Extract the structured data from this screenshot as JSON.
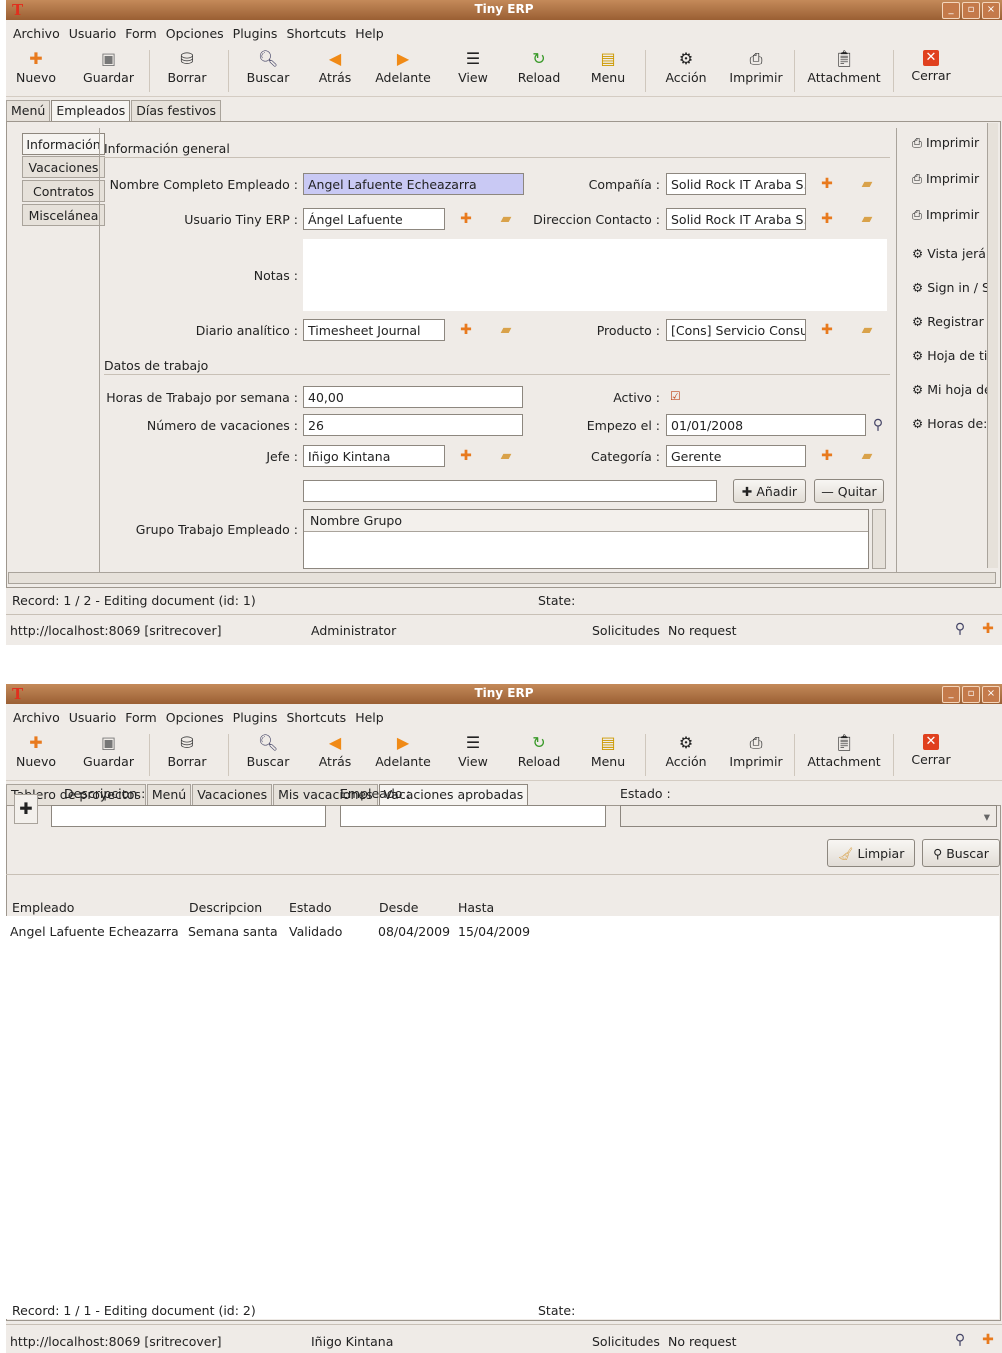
{
  "window1": {
    "title": "Tiny ERP",
    "menu": [
      "Archivo",
      "Usuario",
      "Form",
      "Opciones",
      "Plugins",
      "Shortcuts",
      "Help"
    ],
    "toolbar": [
      "Nuevo",
      "Guardar",
      "Borrar",
      "Buscar",
      "Atrás",
      "Adelante",
      "View",
      "Reload",
      "Menu",
      "Acción",
      "Imprimir",
      "Attachment",
      "Cerrar"
    ],
    "tabs": [
      "Menú",
      "Empleados",
      "Días festivos"
    ],
    "vtabs": [
      "Información",
      "Vacaciones",
      "Contratos",
      "Miscelánea"
    ],
    "section_general": "Información general",
    "labels": {
      "nombre": "Nombre Completo Empleado :",
      "compania": "Compañía :",
      "usuario": "Usuario Tiny ERP :",
      "direccion": "Direccion Contacto :",
      "notas": "Notas :",
      "diario": "Diario analítico :",
      "producto": "Producto :",
      "horas": "Horas de Trabajo por semana :",
      "activo": "Activo :",
      "vacaciones": "Número de vacaciones :",
      "empezo": "Empezo el :",
      "jefe": "Jefe :",
      "categoria": "Categoría :",
      "grupo": "Grupo Trabajo Empleado :"
    },
    "values": {
      "nombre": "Angel Lafuente Echeazarra",
      "compania": "Solid Rock IT Araba S.",
      "usuario": "Ángel Lafuente",
      "direccion": "Solid Rock IT Araba S.",
      "diario": "Timesheet Journal",
      "producto": "[Cons] Servicio Consu",
      "horas": "40,00",
      "vacaciones": "26",
      "empezo": "01/01/2008",
      "jefe": "Iñigo Kintana",
      "categoria": "Gerente"
    },
    "section_trabajo": "Datos de trabajo",
    "add_button": "Añadir",
    "remove_button": "Quitar",
    "group_column": "Nombre Grupo",
    "side_actions": [
      "Imprimir",
      "Imprimir",
      "Imprimir",
      "Vista jerá",
      "Sign in / S",
      "Registrar",
      "Hoja de ti",
      "Mi hoja de",
      "Horas de:"
    ],
    "record_status": "Record: 1 / 2 - Editing document (id: 1)",
    "state_label": "State:",
    "server": "http://localhost:8069 [sritrecover]",
    "user": "Administrator",
    "solicitudes_label": "Solicitudes",
    "solicitudes_value": "No request"
  },
  "window2": {
    "title": "Tiny ERP",
    "menu": [
      "Archivo",
      "Usuario",
      "Form",
      "Opciones",
      "Plugins",
      "Shortcuts",
      "Help"
    ],
    "toolbar": [
      "Nuevo",
      "Guardar",
      "Borrar",
      "Buscar",
      "Atrás",
      "Adelante",
      "View",
      "Reload",
      "Menu",
      "Acción",
      "Imprimir",
      "Attachment",
      "Cerrar"
    ],
    "tabs": [
      "Tablero de proyectos",
      "Menú",
      "Vacaciones",
      "Mis vacaciones",
      "Vacaciones aprobadas"
    ],
    "filters": {
      "descripcion": "Descripcion :",
      "empleado": "Empleado :",
      "estado": "Estado :"
    },
    "clear_button": "Limpiar",
    "search_button": "Buscar",
    "columns": [
      "Empleado",
      "Descripcion",
      "Estado",
      "Desde",
      "Hasta"
    ],
    "rows": [
      [
        "Angel Lafuente Echeazarra",
        "Semana santa",
        "Validado",
        "08/04/2009",
        "15/04/2009"
      ]
    ],
    "record_status": "Record: 1 / 1 - Editing document (id: 2)",
    "state_label": "State:",
    "server": "http://localhost:8069 [sritrecover]",
    "user": "Iñigo Kintana",
    "solicitudes_label": "Solicitudes",
    "solicitudes_value": "No request"
  },
  "icons": [
    "new-icon",
    "save-icon",
    "delete-icon",
    "search-icon",
    "back-icon",
    "forward-icon",
    "view-icon",
    "reload-icon",
    "menu-icon",
    "action-icon",
    "print-icon",
    "attachment-icon",
    "close-icon"
  ]
}
